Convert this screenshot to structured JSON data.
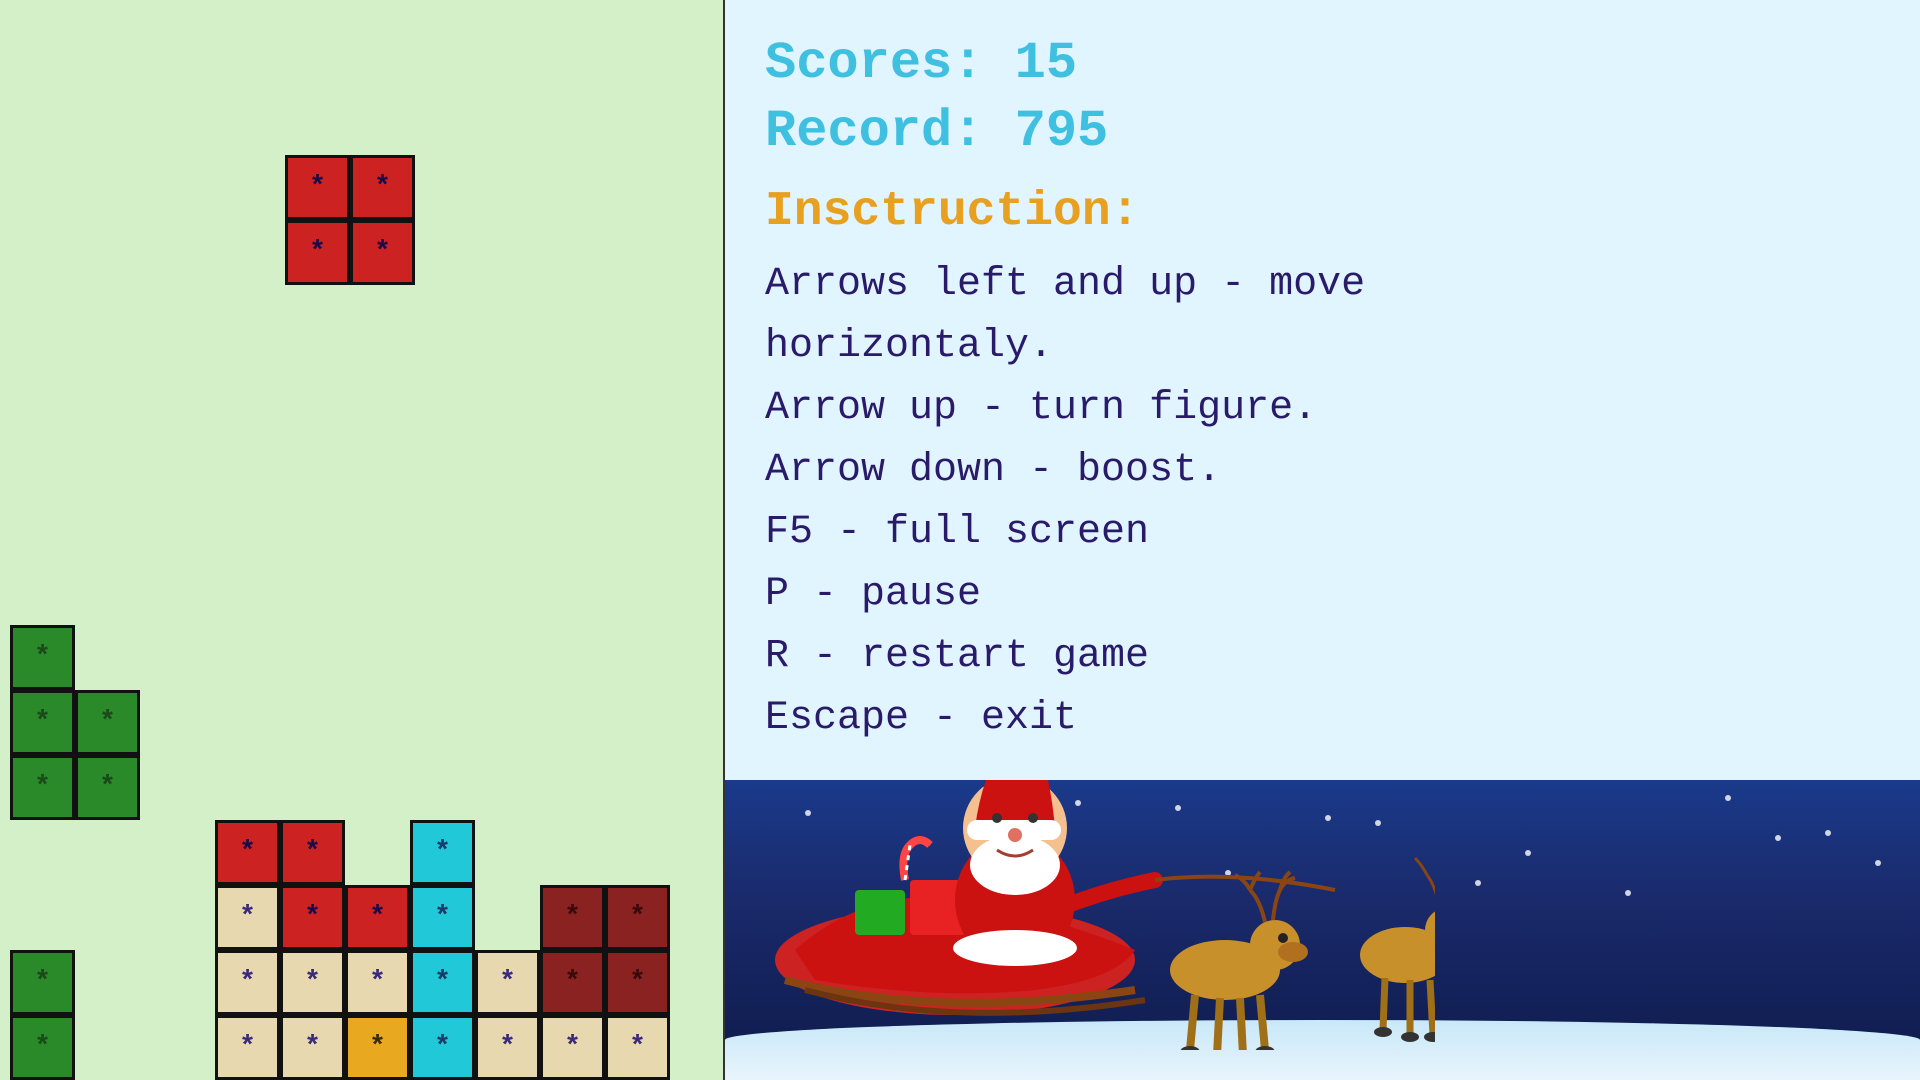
{
  "scores": {
    "label": "Scores: 15",
    "record_label": "Record: 795"
  },
  "instruction": {
    "title": "Insctruction:",
    "lines": [
      "Arrows left and up - move",
      "horizontaly.",
      "Arrow up - turn figure.",
      "Arrow down - boost.",
      "F5 - full screen",
      "P - pause",
      "R - restart game",
      "Escape - exit"
    ]
  },
  "colors": {
    "board_bg": "#d4f0c8",
    "info_bg": "#e0f5ff",
    "santa_bg": "#1a3a8b",
    "score_color": "#40c0e0",
    "title_color": "#e8a020",
    "text_color": "#2a1a6a"
  }
}
